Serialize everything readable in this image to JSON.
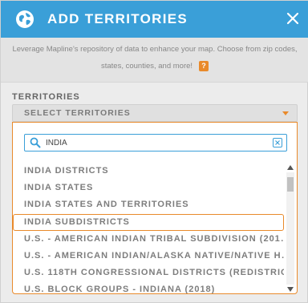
{
  "header": {
    "title": "ADD TERRITORIES",
    "globe_icon": "globe-icon",
    "close_icon": "close-icon",
    "color": "#3a9fd8"
  },
  "description": {
    "line1": "Leverage Mapline's repository of data to enhance your map. Choose from zip codes,",
    "line2": "states, counties, and more!",
    "help_label": "?"
  },
  "territories": {
    "label": "TERRITORIES",
    "select_placeholder": "SELECT TERRITORIES"
  },
  "search": {
    "value": "INDIA",
    "icon": "search-icon",
    "clear_icon": "clear-icon"
  },
  "results": [
    "INDIA DISTRICTS",
    "INDIA STATES",
    "INDIA STATES AND TERRITORIES",
    "INDIA SUBDISTRICTS",
    "U.S. - AMERICAN INDIAN TRIBAL SUBDIVISION (201…",
    "U.S. - AMERICAN INDIAN/ALASKA NATIVE/NATIVE H…",
    "U.S. 118TH CONGRESSIONAL DISTRICTS (REDISTRIC…",
    "U.S. BLOCK GROUPS - INDIANA (2018)"
  ],
  "selected_index": 3,
  "colors": {
    "accent": "#e98a2b",
    "primary": "#3a9fd8"
  }
}
